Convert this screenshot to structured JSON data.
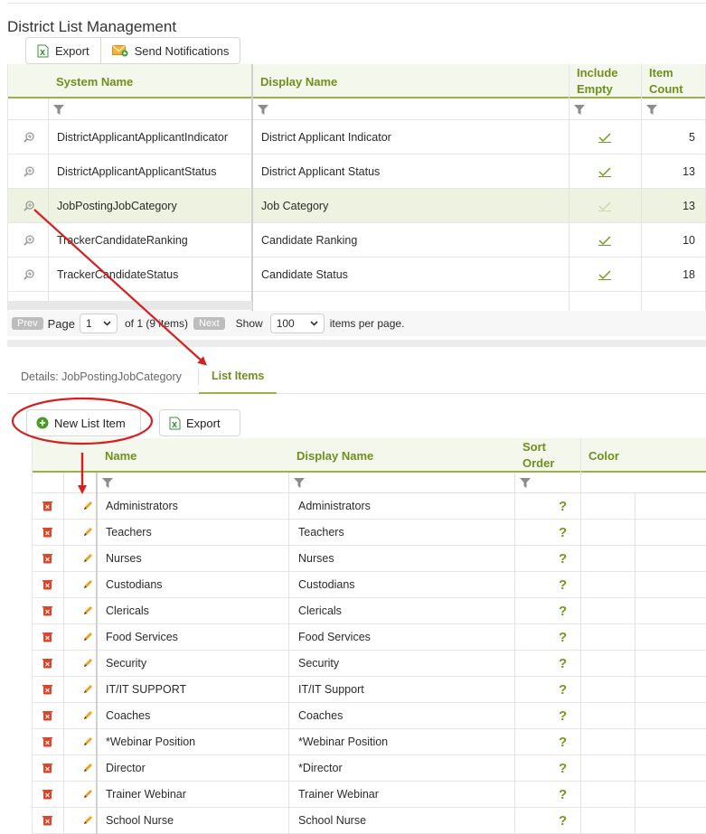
{
  "page": {
    "title": "District List Management"
  },
  "toolbar": {
    "export_label": "Export",
    "notify_label": "Send Notifications"
  },
  "grid1": {
    "headers": {
      "system_name": "System Name",
      "display_name": "Display Name",
      "include_empty_1": "Include",
      "include_empty_2": "Empty",
      "item_count_1": "Item",
      "item_count_2": "Count"
    },
    "rows": [
      {
        "system_name": "DistrictApplicantApplicantIndicator",
        "display_name": "District Applicant Indicator",
        "include_empty": true,
        "item_count": "5"
      },
      {
        "system_name": "DistrictApplicantApplicantStatus",
        "display_name": "District Applicant Status",
        "include_empty": true,
        "item_count": "13"
      },
      {
        "system_name": "JobPostingJobCategory",
        "display_name": "Job Category",
        "include_empty": true,
        "item_count": "13"
      },
      {
        "system_name": "TrackerCandidateRanking",
        "display_name": "Candidate Ranking",
        "include_empty": true,
        "item_count": "10"
      },
      {
        "system_name": "TrackerCandidateStatus",
        "display_name": "Candidate Status",
        "include_empty": true,
        "item_count": "18"
      }
    ],
    "selected_index": 2
  },
  "pager": {
    "prev": "Prev",
    "page_label": "Page",
    "page_value": "1",
    "of_text": "of 1 (9 items)",
    "next": "Next",
    "show_label": "Show",
    "per_page_value": "100",
    "per_page_text": "items per page."
  },
  "tabs": {
    "details": "Details: JobPostingJobCategory",
    "list_items": "List Items"
  },
  "toolbar2": {
    "new_item_label": "New List Item",
    "export_label": "Export"
  },
  "grid2": {
    "headers": {
      "name": "Name",
      "display_name": "Display Name",
      "sort_order_1": "Sort",
      "sort_order_2": "Order",
      "color": "Color"
    },
    "sort_placeholder": "?",
    "rows": [
      {
        "name": "Administrators",
        "display_name": "Administrators"
      },
      {
        "name": "Teachers",
        "display_name": "Teachers"
      },
      {
        "name": "Nurses",
        "display_name": "Nurses"
      },
      {
        "name": "Custodians",
        "display_name": "Custodians"
      },
      {
        "name": "Clericals",
        "display_name": "Clericals"
      },
      {
        "name": "Food Services",
        "display_name": "Food Services"
      },
      {
        "name": "Security",
        "display_name": "Security"
      },
      {
        "name": "IT/IT SUPPORT",
        "display_name": "IT/IT Support"
      },
      {
        "name": "Coaches",
        "display_name": "Coaches"
      },
      {
        "name": "*Webinar Position",
        "display_name": "*Webinar Position"
      },
      {
        "name": "Director",
        "display_name": "*Director"
      },
      {
        "name": "Trainer Webinar",
        "display_name": "Trainer Webinar"
      },
      {
        "name": "School Nurse",
        "display_name": "School Nurse"
      }
    ]
  },
  "colors": {
    "accent": "#6f8f1f",
    "accent_line": "#9ab04a",
    "selected_row": "#edf3e0",
    "delete": "#d9462b",
    "annotation": "#d42020"
  },
  "icons": {
    "export": "excel-icon",
    "notify": "envelope-icon",
    "view": "magnifier-icon",
    "check": "check-icon",
    "add": "plus-circle-icon",
    "delete": "trash-icon",
    "edit": "pencil-icon",
    "filter": "funnel-icon"
  }
}
